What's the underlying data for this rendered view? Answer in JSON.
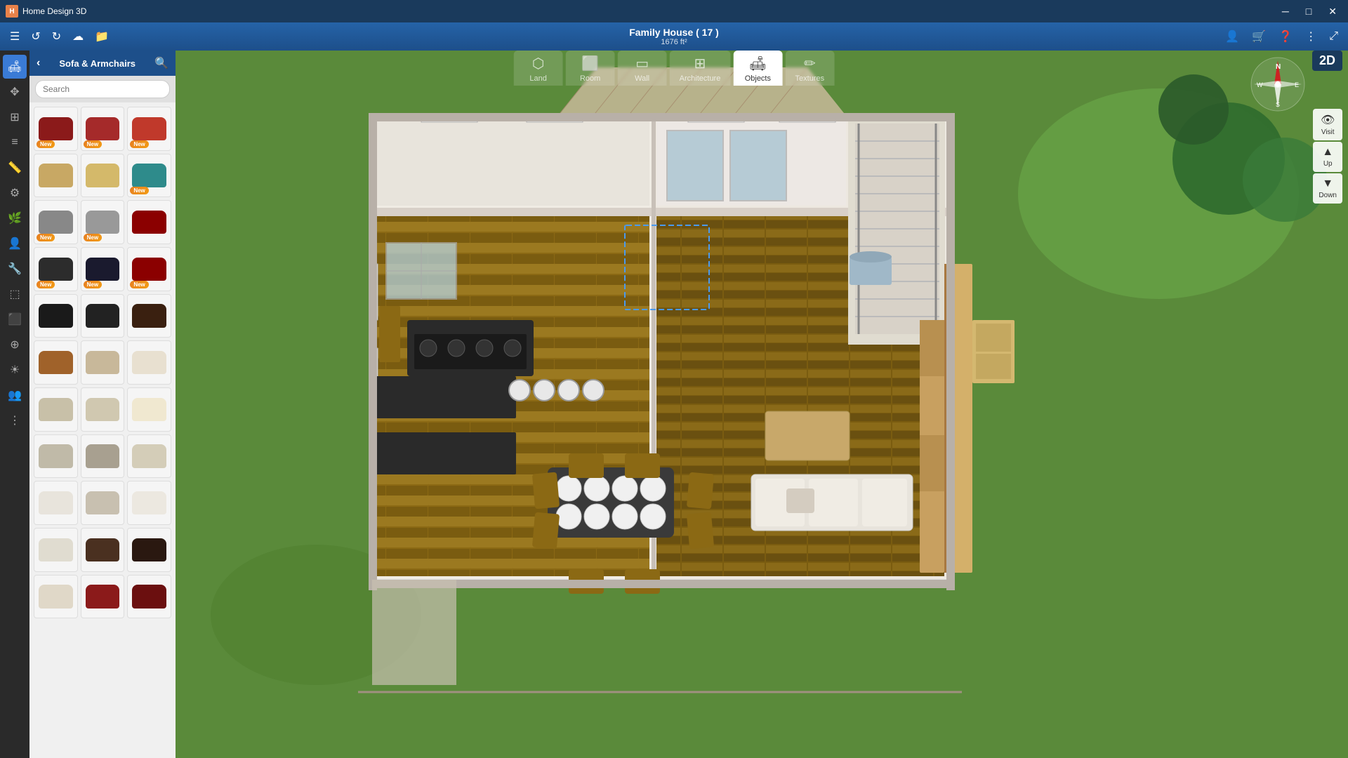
{
  "app": {
    "title": "Home Design 3D",
    "icon": "H"
  },
  "titlebar": {
    "title": "Home Design 3D",
    "minimize": "─",
    "maximize": "□",
    "close": "✕"
  },
  "project": {
    "name": "Family House ( 17 )",
    "size": "1676 ft²"
  },
  "toolbar": {
    "menu_icon": "☰",
    "undo": "↺",
    "redo": "↻",
    "cloud": "☁",
    "folder": "📁"
  },
  "nav_tabs": [
    {
      "id": "land",
      "label": "Land",
      "icon": "⬡",
      "active": false
    },
    {
      "id": "room",
      "label": "Room",
      "icon": "⬜",
      "active": false
    },
    {
      "id": "wall",
      "label": "Wall",
      "icon": "▭",
      "active": false
    },
    {
      "id": "architecture",
      "label": "Architecture",
      "icon": "⊞",
      "active": false
    },
    {
      "id": "objects",
      "label": "Objects",
      "icon": "🛋",
      "active": true
    },
    {
      "id": "textures",
      "label": "Textures",
      "icon": "✏",
      "active": false
    }
  ],
  "sidebar": {
    "category_title": "Sofa & Armchairs",
    "search_placeholder": "Search"
  },
  "left_icons": [
    {
      "id": "sofas",
      "icon": "🛋",
      "active": true
    },
    {
      "id": "move",
      "icon": "✥",
      "active": false
    },
    {
      "id": "grid",
      "icon": "⊞",
      "active": false
    },
    {
      "id": "layers",
      "icon": "≡",
      "active": false
    },
    {
      "id": "measure",
      "icon": "📏",
      "active": false
    },
    {
      "id": "settings",
      "icon": "⚙",
      "active": false
    },
    {
      "id": "plants",
      "icon": "🌿",
      "active": false
    },
    {
      "id": "person",
      "icon": "👤",
      "active": false
    },
    {
      "id": "tools",
      "icon": "🔧",
      "active": false
    },
    {
      "id": "fence",
      "icon": "⬚",
      "active": false
    },
    {
      "id": "stairs",
      "icon": "⬛",
      "active": false
    },
    {
      "id": "group",
      "icon": "⊕",
      "active": false
    },
    {
      "id": "sun",
      "icon": "☀",
      "active": false
    },
    {
      "id": "people2",
      "icon": "👥",
      "active": false
    },
    {
      "id": "more",
      "icon": "⊞",
      "active": false
    }
  ],
  "items": [
    {
      "id": 1,
      "color": "#8B1A1A",
      "new": true,
      "row": 0,
      "col": 0
    },
    {
      "id": 2,
      "color": "#A52A2A",
      "new": true,
      "row": 0,
      "col": 1
    },
    {
      "id": 3,
      "color": "#C0392B",
      "new": true,
      "row": 0,
      "col": 2
    },
    {
      "id": 4,
      "color": "#C8A864",
      "new": false,
      "row": 1,
      "col": 0
    },
    {
      "id": 5,
      "color": "#D4B96A",
      "new": false,
      "row": 1,
      "col": 1
    },
    {
      "id": 6,
      "color": "#2E8B8B",
      "new": true,
      "row": 1,
      "col": 2
    },
    {
      "id": 7,
      "color": "#888888",
      "new": true,
      "row": 2,
      "col": 0
    },
    {
      "id": 8,
      "color": "#999999",
      "new": true,
      "row": 2,
      "col": 1
    },
    {
      "id": 9,
      "color": "#8B0000",
      "new": false,
      "row": 2,
      "col": 2
    },
    {
      "id": 10,
      "color": "#2C2C2C",
      "new": true,
      "row": 3,
      "col": 0
    },
    {
      "id": 11,
      "color": "#1a1a2e",
      "new": true,
      "row": 3,
      "col": 1
    },
    {
      "id": 12,
      "color": "#8B0000",
      "new": true,
      "row": 3,
      "col": 2
    },
    {
      "id": 13,
      "color": "#1a1a1a",
      "new": false,
      "row": 4,
      "col": 0
    },
    {
      "id": 14,
      "color": "#222222",
      "new": false,
      "row": 4,
      "col": 1
    },
    {
      "id": 15,
      "color": "#3a2010",
      "new": false,
      "row": 4,
      "col": 2
    },
    {
      "id": 16,
      "color": "#a0622a",
      "new": false,
      "row": 5,
      "col": 0
    },
    {
      "id": 17,
      "color": "#c8b89a",
      "new": false,
      "row": 5,
      "col": 1
    },
    {
      "id": 18,
      "color": "#e8e0d0",
      "new": false,
      "row": 5,
      "col": 2
    },
    {
      "id": 19,
      "color": "#c8c0a8",
      "new": false,
      "row": 6,
      "col": 0
    },
    {
      "id": 20,
      "color": "#d0c8b0",
      "new": false,
      "row": 6,
      "col": 1
    },
    {
      "id": 21,
      "color": "#f0e8d0",
      "new": false,
      "row": 6,
      "col": 2
    },
    {
      "id": 22,
      "color": "#c0baa8",
      "new": false,
      "row": 7,
      "col": 0
    },
    {
      "id": 23,
      "color": "#a8a090",
      "new": false,
      "row": 7,
      "col": 1
    },
    {
      "id": 24,
      "color": "#d4cdb8",
      "new": false,
      "row": 7,
      "col": 2
    },
    {
      "id": 25,
      "color": "#e8e4dc",
      "new": false,
      "row": 8,
      "col": 0
    },
    {
      "id": 26,
      "color": "#c8c0b0",
      "new": false,
      "row": 8,
      "col": 1
    },
    {
      "id": 27,
      "color": "#ece8e0",
      "new": false,
      "row": 8,
      "col": 2
    },
    {
      "id": 28,
      "color": "#e0dcd0",
      "new": false,
      "row": 9,
      "col": 0
    },
    {
      "id": 29,
      "color": "#4a3020",
      "new": false,
      "row": 9,
      "col": 1
    },
    {
      "id": 30,
      "color": "#2a1810",
      "new": false,
      "row": 9,
      "col": 2
    },
    {
      "id": 31,
      "color": "#e0d8c8",
      "new": false,
      "row": 10,
      "col": 0
    },
    {
      "id": 32,
      "color": "#8B1A1A",
      "new": false,
      "row": 10,
      "col": 1
    },
    {
      "id": 33,
      "color": "#6B0F0F",
      "new": false,
      "row": 10,
      "col": 2
    }
  ],
  "view": {
    "mode_2d": "2D",
    "visit_label": "Visit",
    "up_label": "Up",
    "down_label": "Down"
  },
  "compass": {
    "north": "N",
    "south": "S",
    "east": "E",
    "west": "W"
  }
}
